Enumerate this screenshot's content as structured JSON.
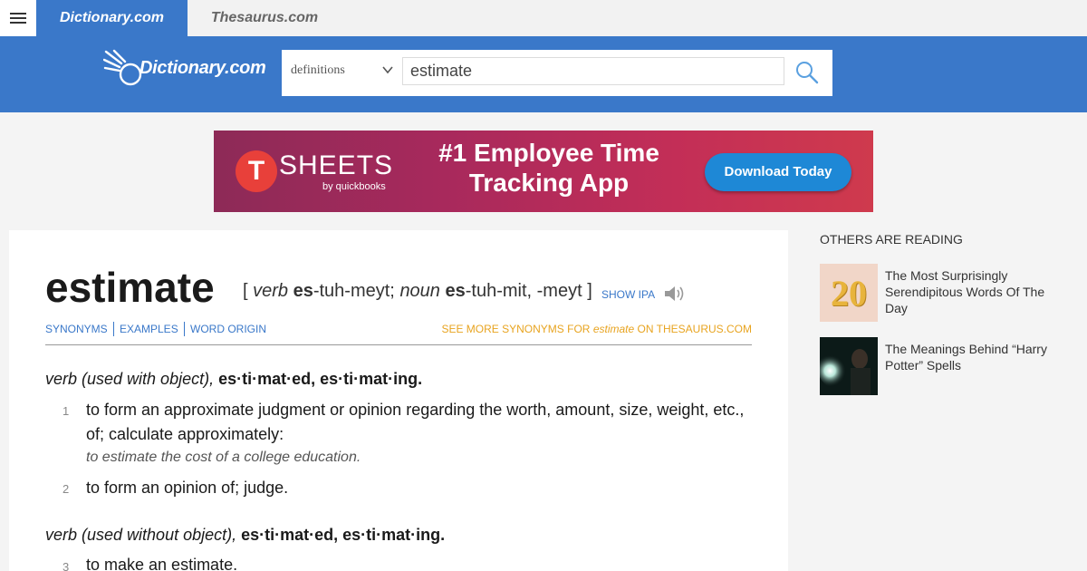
{
  "topbar": {
    "tabs": [
      {
        "label": "Dictionary.com"
      },
      {
        "label": "Thesaurus.com"
      }
    ]
  },
  "header": {
    "logo_text": "Dictionary.com",
    "search": {
      "select_value": "definitions",
      "input_value": "estimate"
    }
  },
  "ad": {
    "brand": "SHEETS",
    "logo_letter": "T",
    "sub": "by quickbooks",
    "headline": "#1 Employee Time Tracking App",
    "cta": "Download Today"
  },
  "entry": {
    "headword": "estimate",
    "pronunciation": {
      "open": "[",
      "pos1": "verb",
      "p1_stress": "es",
      "p1_rest": "-tuh-meyt;",
      "pos2": "noun",
      "p2_stress": "es",
      "p2_rest": "-tuh-mit, -meyt",
      "close": "]"
    },
    "show_ipa": "SHOW IPA",
    "subnav": {
      "synonyms": "SYNONYMS",
      "examples": "EXAMPLES",
      "word_origin": "WORD ORIGIN",
      "see_more_prefix": "SEE MORE SYNONYMS FOR",
      "see_more_word": "estimate",
      "see_more_suffix": "ON THESAURUS.COM"
    },
    "sections": [
      {
        "pos": "verb (used with object),",
        "inflections": "es·ti·mat·ed, es·ti·mat·ing."
      },
      {
        "pos": "verb (used without object),",
        "inflections": "es·ti·mat·ed, es·ti·mat·ing."
      }
    ],
    "definitions": [
      {
        "num": "1",
        "text": "to form an approximate judgment or opinion regarding the worth, amount, size, weight, etc., of; calculate approximately:",
        "example": "to estimate the cost of a college education."
      },
      {
        "num": "2",
        "text": "to form an opinion of; judge."
      },
      {
        "num": "3",
        "text": "to make an estimate."
      }
    ]
  },
  "sidebar": {
    "title": "OTHERS ARE READING",
    "items": [
      {
        "title": "The Most Surprisingly Serendipitous Words Of The Day",
        "thumb_label": "20"
      },
      {
        "title": "The Meanings Behind “Harry Potter” Spells"
      }
    ]
  },
  "colors": {
    "brand_blue": "#3a78c9",
    "accent_orange": "#e8a420"
  }
}
